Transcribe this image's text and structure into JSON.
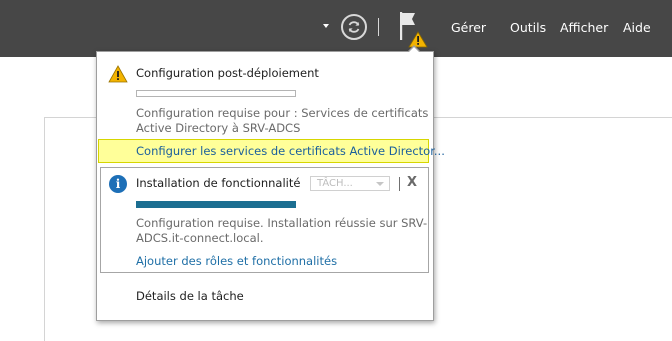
{
  "header": {
    "menu": [
      "Gérer",
      "Outils",
      "Afficher",
      "Aide"
    ]
  },
  "icons": {
    "dropdown": "chevron-down-icon",
    "refresh": "refresh-icon",
    "flag": "notification-flag-icon",
    "warning": "warning-icon",
    "info": "info-icon",
    "close": "close-icon"
  },
  "colors": {
    "topbar": "#474747",
    "highlight": "#ffff99",
    "progress": "#1b6e91",
    "link": "#1f6fa6",
    "warning": "#f3b300",
    "info": "#1d6fb7"
  },
  "notifications": [
    {
      "title": "Configuration post-déploiement",
      "progress": 0,
      "description_line1": "Configuration requise pour : Services de certificats",
      "description_line2": "Active Directory à SRV-ADCS",
      "action_link": "Configurer les services de certificats Active Director..."
    },
    {
      "title": "Installation de fonctionnalité",
      "task_select": "TÂCH...",
      "close": "X",
      "progress": 1,
      "description_line1": "Configuration requise. Installation réussie sur SRV-",
      "description_line2": "ADCS.it-connect.local.",
      "action_link": "Ajouter des rôles et fonctionnalités"
    }
  ],
  "footer_link": "Détails de la tâche"
}
